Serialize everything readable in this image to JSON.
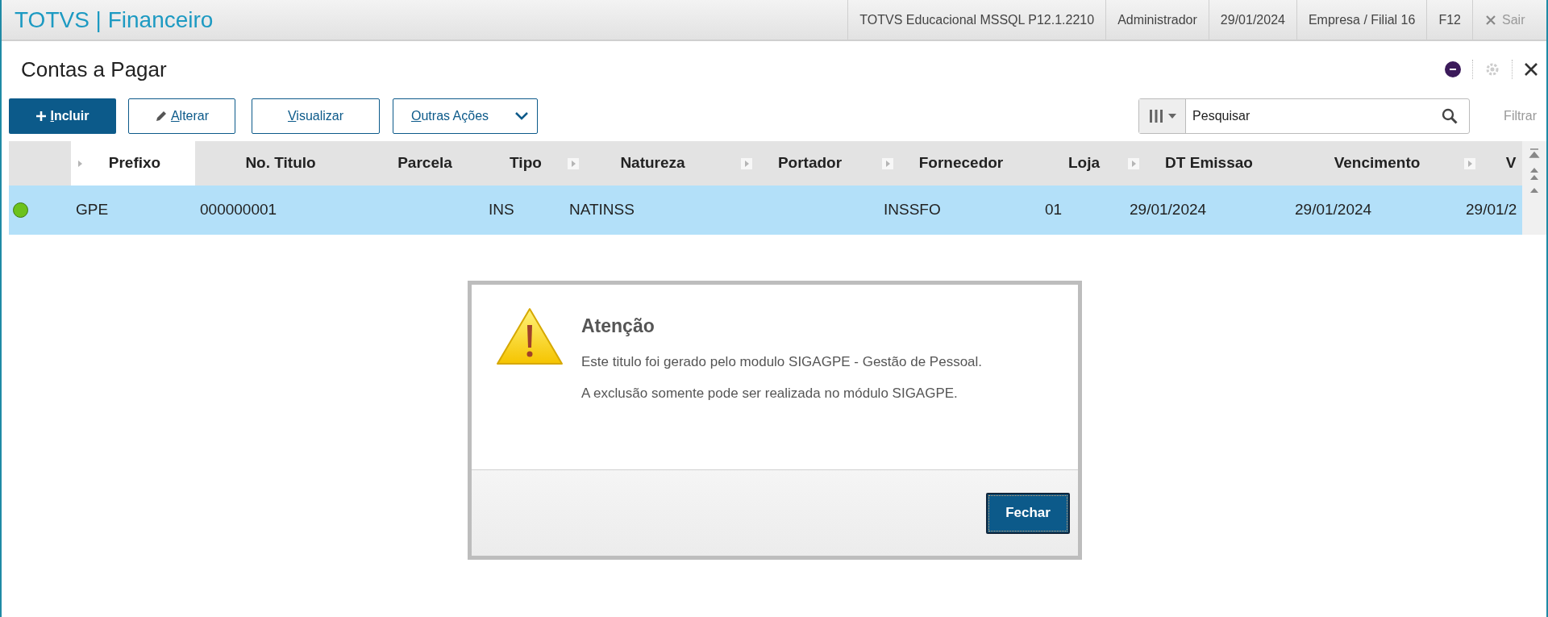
{
  "app_bar": {
    "title": "TOTVS | Financeiro",
    "items": [
      "TOTVS Educacional MSSQL P12.1.2210",
      "Administrador",
      "29/01/2024",
      "Empresa / Filial 16",
      "F12"
    ],
    "exit_label": "Sair"
  },
  "page": {
    "title": "Contas a Pagar"
  },
  "toolbar": {
    "buttons": [
      {
        "label": "Incluir",
        "kind": "primary"
      },
      {
        "label": "Alterar",
        "kind": "edit"
      },
      {
        "label": "Visualizar",
        "kind": "plain"
      },
      {
        "label": "Outras Ações",
        "kind": "menu"
      }
    ],
    "search": {
      "placeholder": "Pesquisar"
    },
    "filter_label": "Filtrar"
  },
  "table": {
    "columns": [
      {
        "label": "Prefixo",
        "sortable": true,
        "selected": true
      },
      {
        "label": "No. Titulo",
        "sortable": false,
        "selected": false
      },
      {
        "label": "Parcela",
        "sortable": false,
        "selected": false
      },
      {
        "label": "Tipo",
        "sortable": false,
        "selected": false
      },
      {
        "label": "Natureza",
        "sortable": true,
        "selected": false
      },
      {
        "label": "Portador",
        "sortable": true,
        "selected": false
      },
      {
        "label": "Fornecedor",
        "sortable": true,
        "selected": false
      },
      {
        "label": "Loja",
        "sortable": false,
        "selected": false
      },
      {
        "label": "DT Emissao",
        "sortable": true,
        "selected": false
      },
      {
        "label": "Vencimento",
        "sortable": false,
        "selected": false
      },
      {
        "label": "V",
        "sortable": true,
        "selected": false
      }
    ],
    "rows": [
      {
        "color": "#6cc21c",
        "selected": true,
        "cells": [
          "GPE",
          "000000001",
          "",
          "INS",
          "NATINSS",
          "",
          "INSSFO",
          "01",
          "29/01/2024",
          "29/01/2024",
          "29/01/2"
        ]
      }
    ]
  },
  "dialog": {
    "title": "Atenção",
    "lines": [
      "Este titulo foi gerado pelo modulo SIGAGPE - Gestão de Pessoal.",
      "A exclusão somente pode ser realizada no módulo SIGAGPE."
    ],
    "button": "Fechar"
  }
}
